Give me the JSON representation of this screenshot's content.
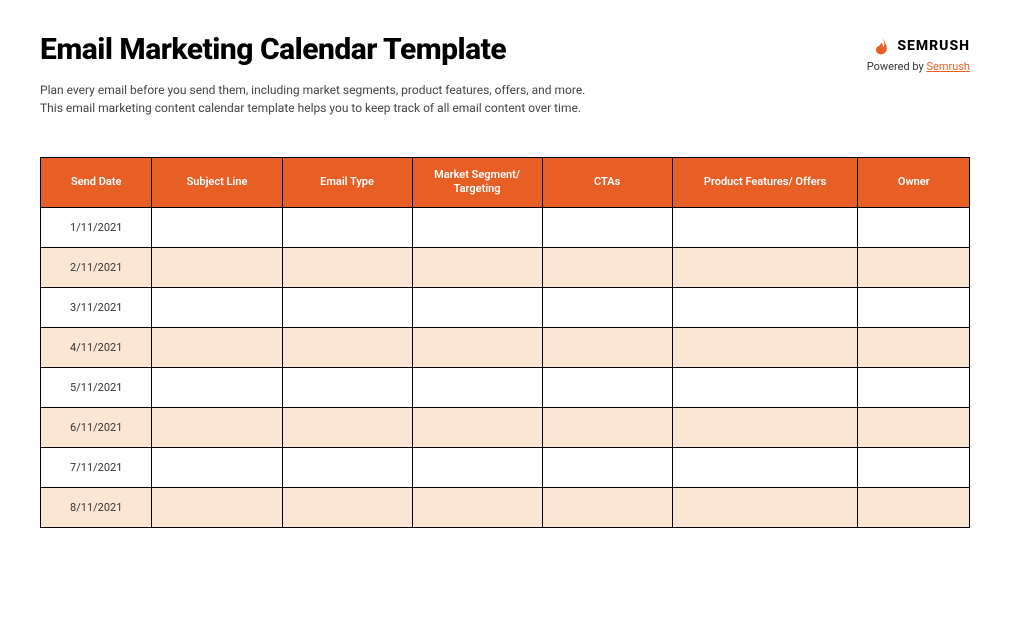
{
  "title": "Email Marketing Calendar Template",
  "brand": {
    "wordmark": "SEMRUSH",
    "powered_prefix": "Powered by ",
    "powered_link": "Semrush"
  },
  "description": "Plan every email before you send them, including market segments, product features, offers, and more.\nThis email marketing content calendar template helps you to keep track of all email content over time.",
  "table": {
    "headers": [
      "Send Date",
      "Subject Line",
      "Email Type",
      "Market Segment/\nTargeting",
      "CTAs",
      "Product Features/ Offers",
      "Owner"
    ],
    "rows": [
      {
        "send_date": "1/11/2021",
        "subject_line": "",
        "email_type": "",
        "market_segment": "",
        "ctas": "",
        "product_features": "",
        "owner": ""
      },
      {
        "send_date": "2/11/2021",
        "subject_line": "",
        "email_type": "",
        "market_segment": "",
        "ctas": "",
        "product_features": "",
        "owner": ""
      },
      {
        "send_date": "3/11/2021",
        "subject_line": "",
        "email_type": "",
        "market_segment": "",
        "ctas": "",
        "product_features": "",
        "owner": ""
      },
      {
        "send_date": "4/11/2021",
        "subject_line": "",
        "email_type": "",
        "market_segment": "",
        "ctas": "",
        "product_features": "",
        "owner": ""
      },
      {
        "send_date": "5/11/2021",
        "subject_line": "",
        "email_type": "",
        "market_segment": "",
        "ctas": "",
        "product_features": "",
        "owner": ""
      },
      {
        "send_date": "6/11/2021",
        "subject_line": "",
        "email_type": "",
        "market_segment": "",
        "ctas": "",
        "product_features": "",
        "owner": ""
      },
      {
        "send_date": "7/11/2021",
        "subject_line": "",
        "email_type": "",
        "market_segment": "",
        "ctas": "",
        "product_features": "",
        "owner": ""
      },
      {
        "send_date": "8/11/2021",
        "subject_line": "",
        "email_type": "",
        "market_segment": "",
        "ctas": "",
        "product_features": "",
        "owner": ""
      }
    ]
  }
}
